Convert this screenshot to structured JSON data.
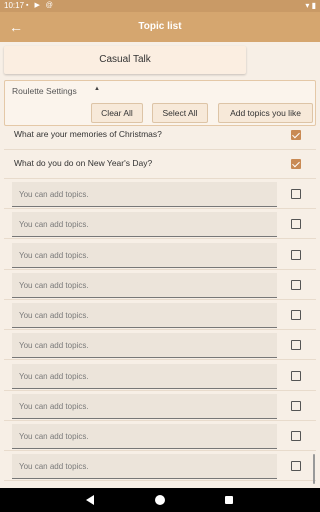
{
  "status_bar": {
    "time": "10:17",
    "left_icons": [
      "sim-icon",
      "play-icon",
      "at-icon"
    ],
    "right_icons": [
      "wifi-icon",
      "battery-icon"
    ]
  },
  "app_bar": {
    "back_icon": "arrow-left-icon",
    "title": "Topic list"
  },
  "category": {
    "label": "Casual Talk"
  },
  "settings": {
    "label": "Roulette Settings",
    "caret_icon": "caret-up-icon",
    "clear_all": "Clear All",
    "select_all": "Select All",
    "add_topics": "Add topics you like"
  },
  "topics": [
    {
      "text": "What are your memories of Christmas?",
      "checked": true
    },
    {
      "text": "What do you do on New Year's Day?",
      "checked": true
    },
    {
      "placeholder": "You can add topics.",
      "value": "",
      "checked": false
    },
    {
      "placeholder": "You can add topics.",
      "value": "",
      "checked": false
    },
    {
      "placeholder": "You can add topics.",
      "value": "",
      "checked": false
    },
    {
      "placeholder": "You can add topics.",
      "value": "",
      "checked": false
    },
    {
      "placeholder": "You can add topics.",
      "value": "",
      "checked": false
    },
    {
      "placeholder": "You can add topics.",
      "value": "",
      "checked": false
    },
    {
      "placeholder": "You can add topics.",
      "value": "",
      "checked": false
    },
    {
      "placeholder": "You can add topics.",
      "value": "",
      "checked": false
    },
    {
      "placeholder": "You can add topics.",
      "value": "",
      "checked": false
    },
    {
      "placeholder": "You can add topics.",
      "value": "",
      "checked": false
    }
  ],
  "colors": {
    "app_bar": "#d5a66f",
    "status_bar": "#c99a66",
    "checkbox_checked": "#c98a54",
    "background": "#f7efe6"
  }
}
